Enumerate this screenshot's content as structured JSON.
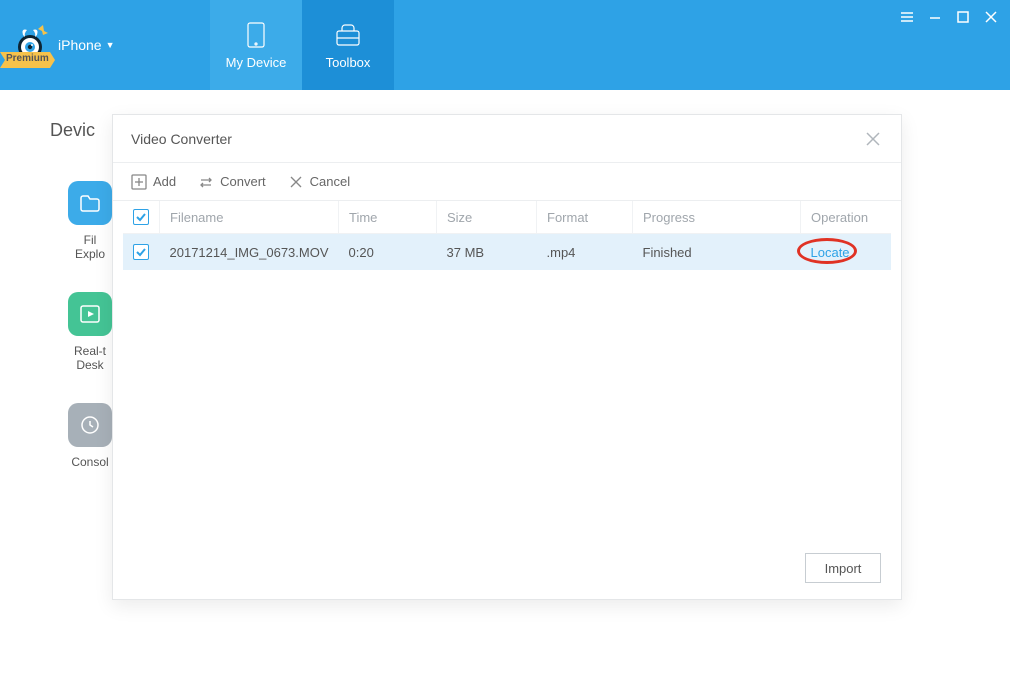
{
  "header": {
    "device_label": "iPhone",
    "premium_badge": "Premium",
    "tabs": [
      {
        "label": "My Device"
      },
      {
        "label": "Toolbox"
      }
    ]
  },
  "page": {
    "title_truncated": "Devic",
    "sidebar_items": [
      {
        "label_line1": "Fil",
        "label_line2": "Explo"
      },
      {
        "label_line1": "Real-t",
        "label_line2": "Desk"
      },
      {
        "label_line1": "Consol",
        "label_line2": ""
      }
    ]
  },
  "modal": {
    "title": "Video Converter",
    "toolbar": {
      "add": "Add",
      "convert": "Convert",
      "cancel": "Cancel"
    },
    "columns": {
      "filename": "Filename",
      "time": "Time",
      "size": "Size",
      "format": "Format",
      "progress": "Progress",
      "operation": "Operation"
    },
    "rows": [
      {
        "checked": true,
        "filename": "20171214_IMG_0673.MOV",
        "time": "0:20",
        "size": "37 MB",
        "format": ".mp4",
        "progress": "Finished",
        "operation": "Locate"
      }
    ],
    "footer": {
      "import": "Import"
    }
  },
  "colors": {
    "accent": "#2ea2e6",
    "annotation": "#e03224"
  }
}
